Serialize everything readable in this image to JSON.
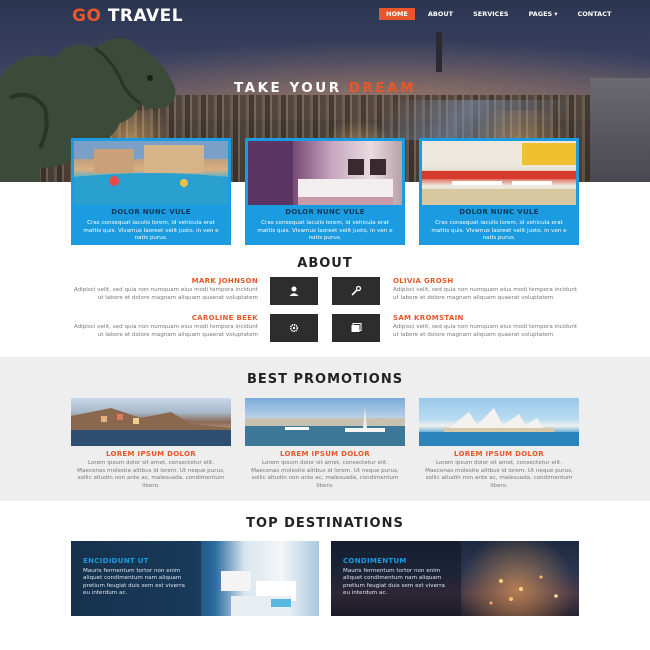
{
  "brand": {
    "prefix": "GO",
    "name": "TRAVEL"
  },
  "nav": [
    {
      "label": "HOME",
      "active": true
    },
    {
      "label": "ABOUT",
      "active": false
    },
    {
      "label": "SERVICES",
      "active": false
    },
    {
      "label": "PAGES",
      "active": false,
      "has_dropdown": true,
      "caret": "▾"
    },
    {
      "label": "CONTACT",
      "active": false
    }
  ],
  "hero": {
    "title_prefix": "TAKE YOUR",
    "title_highlight": "DREAM"
  },
  "features": [
    {
      "title": "DOLOR NUNC VULE",
      "text": "Cras consequat iaculis lorem, id vehicula erat mattis quis. Vivamus laoreet velit justo, in ven e natis purus.",
      "image": "resort-pool"
    },
    {
      "title": "DOLOR NUNC VULE",
      "text": "Cras consequat iaculis lorem, id vehicula erat mattis quis. Vivamus laoreet velit justo, in ven e natis purus.",
      "image": "hotel-room"
    },
    {
      "title": "DOLOR NUNC VULE",
      "text": "Cras consequat iaculis lorem, id vehicula erat mattis quis. Vivamus laoreet velit justo, in ven e natis purus.",
      "image": "cafe-interior"
    }
  ],
  "about": {
    "title": "ABOUT",
    "people": [
      {
        "name": "MARK JOHNSON",
        "text": "Adipisci velit, sed quia non numquam eius modi tempora incidunt ut labore et dolore magnam aliquam quaerat voluptatem",
        "icon": "user-icon"
      },
      {
        "name": "OLIVIA GROSH",
        "text": "Adipisci velit, sed quia non numquam eius modi tempora incidunt ut labore et dolore magnam aliquam quaerat voluptatem",
        "icon": "wrench-icon"
      },
      {
        "name": "CAROLINE BEEK",
        "text": "Adipisci velit, sed quia non numquam eius modi tempora incidunt ut labore et dolore magnam aliquam quaerat voluptatem",
        "icon": "gear-icon"
      },
      {
        "name": "SAM KROMSTAIN",
        "text": "Adipisci velit, sed quia non numquam eius modi tempora incidunt ut labore et dolore magnam aliquam quaerat voluptatem",
        "icon": "window-icon"
      }
    ]
  },
  "promotions": {
    "title": "BEST PROMOTIONS",
    "items": [
      {
        "title": "LOREM IPSUM DOLOR",
        "text": "Lorem ipsum dolor sit amet, consectetur elit. Maecenas molestie alitbus id lorem. Ut neque purus, sollic altudin non ante ac, malesuada, condimentum libero.",
        "image": "coastal-village"
      },
      {
        "title": "LOREM IPSUM DOLOR",
        "text": "Lorem ipsum dolor sit amet, consectetur elit. Maecenas molestie alitbus id lorem. Ut neque purus, sollic altudin non ante ac, malesuada, condimentum libero.",
        "image": "harbor-yachts"
      },
      {
        "title": "LOREM IPSUM DOLOR",
        "text": "Lorem ipsum dolor sit amet, consectetur elit. Maecenas molestie alitbus id lorem. Ut neque purus, sollic altudin non ante ac, malesuada, condimentum libero.",
        "image": "sydney-opera-house"
      }
    ]
  },
  "destinations": {
    "title": "TOP DESTINATIONS",
    "items": [
      {
        "title": "ENCIDIDUNT UT",
        "text": "Mauris fermentum tortor non enim aliquet condimentum nam aliquam pretium feugiat duis sem est viverra eu interdum ac.",
        "image": "santorini-coast"
      },
      {
        "title": "CONDIMENTUM",
        "text": "Mauris fermentum tortor non enim aliquet condimentum nam aliquam pretium feugiat duis sem est viverra eu interdum ac.",
        "image": "city-at-night"
      }
    ]
  },
  "colors": {
    "accent": "#e8572a",
    "blue": "#1b9be0",
    "dark_box": "#2d2d2d",
    "band": "#eeeeee"
  }
}
